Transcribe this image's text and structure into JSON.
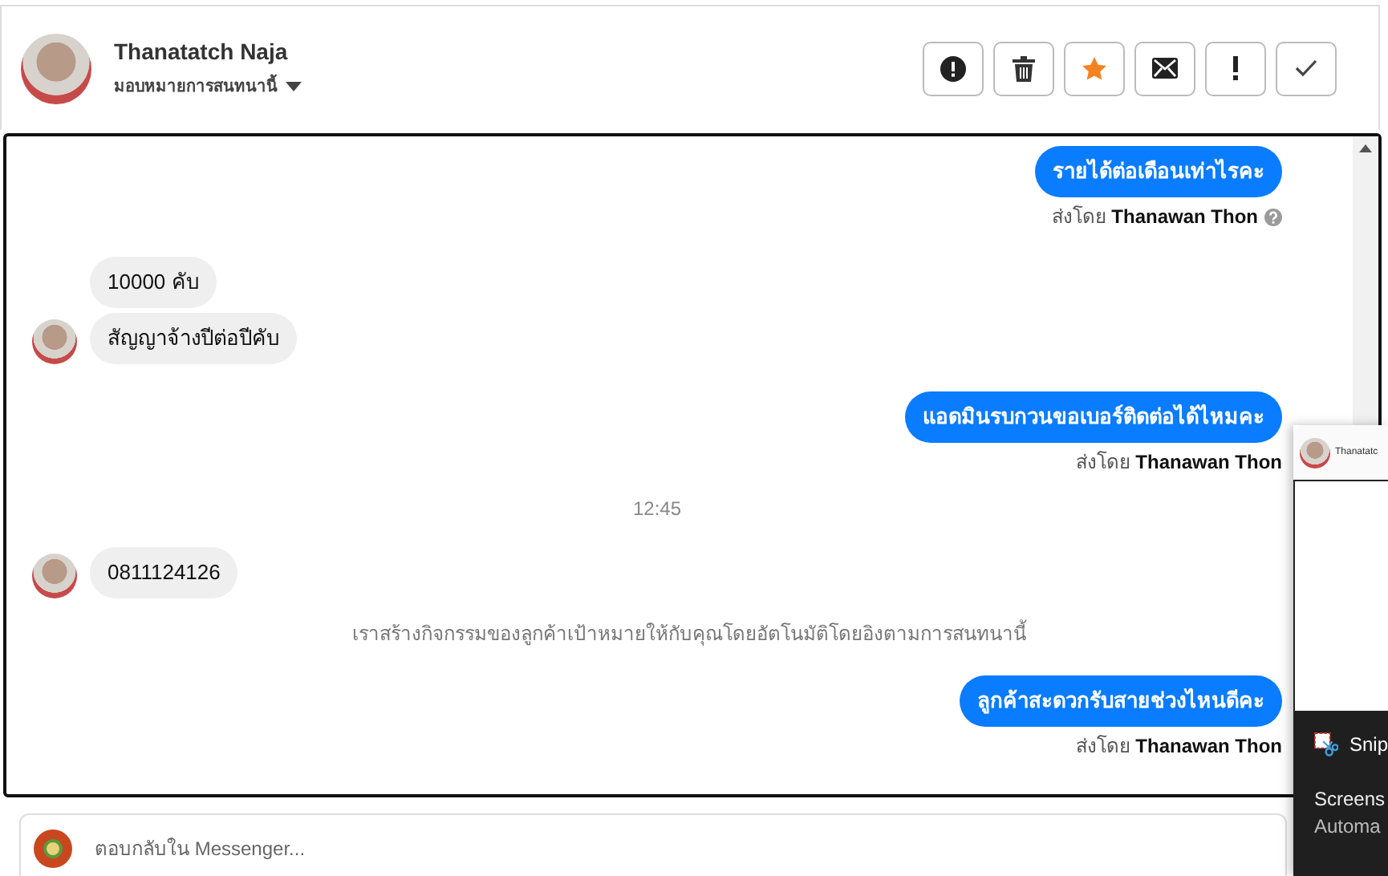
{
  "header": {
    "name": "Thanatatch Naja",
    "subtitle": "มอบหมายการสนทนานี้"
  },
  "toolbar": [
    {
      "kind": "alert"
    },
    {
      "kind": "trash"
    },
    {
      "kind": "star"
    },
    {
      "kind": "mail"
    },
    {
      "kind": "exclaim"
    },
    {
      "kind": "check"
    }
  ],
  "messages": [
    {
      "kind": "outgoing",
      "text": "รายได้ต่อเดือนเท่าไรคะ",
      "byline": "ส่งโดย **Thanawan Thon**",
      "help_icon": true
    },
    {
      "kind": "incoming",
      "text": "10000 คับ",
      "avatar": false
    },
    {
      "kind": "incoming",
      "text": "สัญญาจ้างปีต่อปีคับ",
      "avatar": true
    },
    {
      "kind": "outgoing",
      "text": "แอดมินรบกวนขอเบอร์ติดต่อได้ไหมคะ",
      "byline": "ส่งโดย **Thanawan Thon**",
      "help_icon": false
    },
    {
      "kind": "time",
      "text": "12:45"
    },
    {
      "kind": "incoming",
      "text": "0811124126",
      "avatar": true
    },
    {
      "kind": "system",
      "text": "เราสร้างกิจกรรมของลูกค้าเป้าหมายให้กับคุณโดยอัตโนมัติโดยอิงตามการสนทนานี้"
    },
    {
      "kind": "outgoing",
      "text": "ลูกค้าสะดวกรับสายช่วงไหนดีคะ",
      "byline": "ส่งโดย **Thanawan Thon**",
      "help_icon": false
    }
  ],
  "reply": {
    "placeholder": "ตอบกลับใน Messenger..."
  },
  "overlay": {
    "preview_name": "Thanatatc",
    "app": "Snip",
    "line_1": "Screens",
    "line_2": "Automa"
  }
}
